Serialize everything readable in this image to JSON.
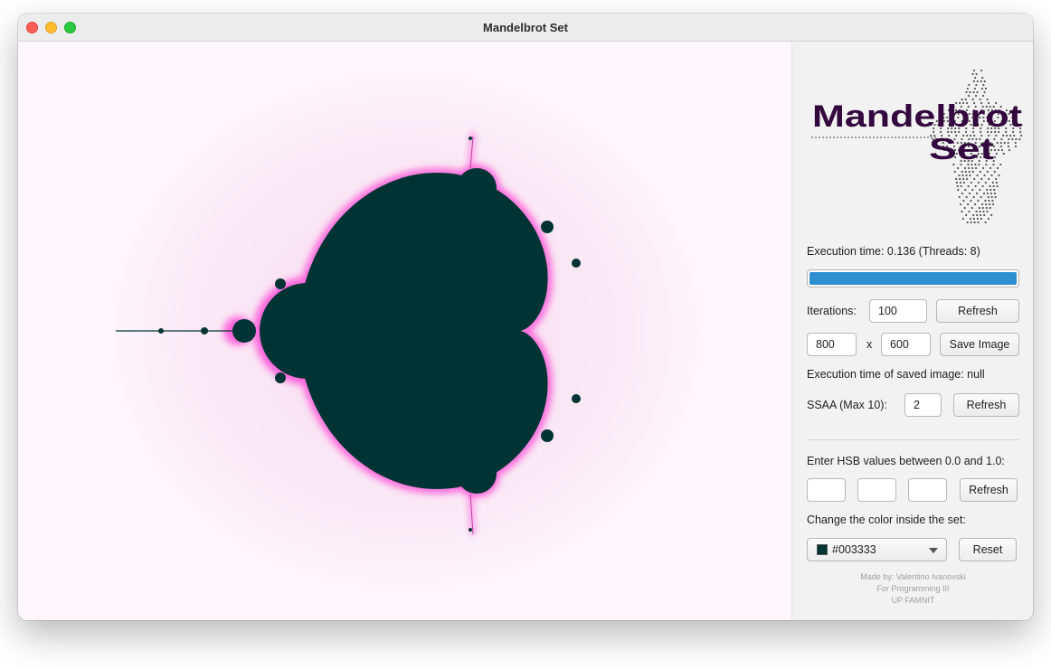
{
  "window": {
    "title": "Mandelbrot Set"
  },
  "colors": {
    "set_inside": "#003333",
    "halo": "#ff4fd8",
    "progress": "#2e8fd1",
    "logo_text": "#33083f"
  },
  "logo": {
    "line1": "Mandelbrot",
    "line2": "Set"
  },
  "panel": {
    "execution_time_label": "Execution time: 0.136  (Threads: 8)",
    "progress_fraction": 1.0,
    "iterations_label": "Iterations:",
    "iterations_value": "100",
    "refresh_label": "Refresh",
    "width_value": "800",
    "x_label": "x",
    "height_value": "600",
    "save_image_label": "Save Image",
    "saved_exec_label": "Execution time of saved image: null",
    "ssaa_label": "SSAA (Max 10):",
    "ssaa_value": "2",
    "hsb_label": "Enter HSB values between 0.0 and 1.0:",
    "hsb_values": [
      "",
      "",
      ""
    ],
    "color_label": "Change the color inside the set:",
    "color_value": "#003333",
    "reset_label": "Reset",
    "credits": [
      "Made by: Valentino Ivanovski",
      "For Programming III",
      "UP FAMNIT"
    ]
  }
}
